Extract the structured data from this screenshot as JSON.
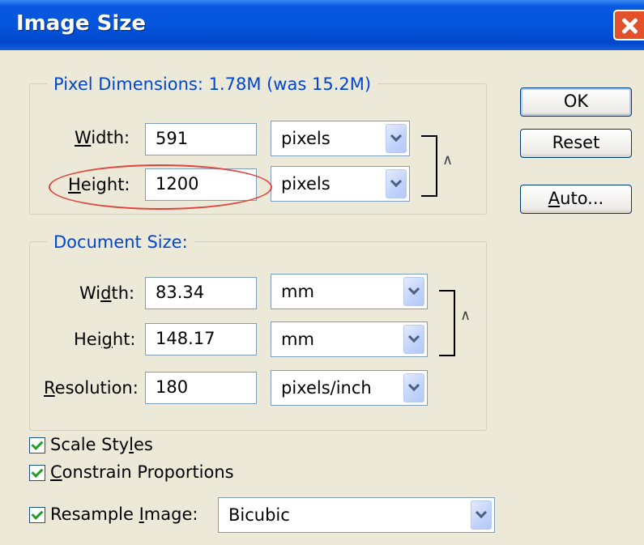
{
  "window": {
    "title": "Image Size"
  },
  "pixel_dimensions": {
    "legend": "Pixel Dimensions:  1.78M (was 15.2M)",
    "width": {
      "label_pre": "",
      "label_key": "W",
      "label_post": "idth:",
      "value": "591",
      "unit": "pixels"
    },
    "height": {
      "label_pre": "",
      "label_key": "H",
      "label_post": "eight:",
      "value": "1200",
      "unit": "pixels"
    }
  },
  "document_size": {
    "legend": "Document Size:",
    "width": {
      "label_pre": "Wi",
      "label_key": "d",
      "label_post": "th:",
      "value": "83.34",
      "unit": "mm"
    },
    "height": {
      "label_pre": "Hei",
      "label_key": "g",
      "label_post": "ht:",
      "value": "148.17",
      "unit": "mm"
    },
    "resolution": {
      "label_pre": "",
      "label_key": "R",
      "label_post": "esolution:",
      "value": "180",
      "unit": "pixels/inch"
    }
  },
  "buttons": {
    "ok": "OK",
    "reset": "Reset",
    "auto_key": "A",
    "auto_rest": "uto..."
  },
  "options": {
    "scale_styles": {
      "pre": "Scale Sty",
      "key": "l",
      "post": "es",
      "checked": true
    },
    "constrain": {
      "pre": "",
      "key": "C",
      "post": "onstrain Proportions",
      "checked": true
    },
    "resample": {
      "pre": "Resample ",
      "key": "I",
      "post": "mage:",
      "checked": true,
      "method": "Bicubic"
    }
  },
  "colors": {
    "titlebar": "#0455dc",
    "legend_text": "#0046d5",
    "highlight_ellipse": "#e0443c"
  }
}
